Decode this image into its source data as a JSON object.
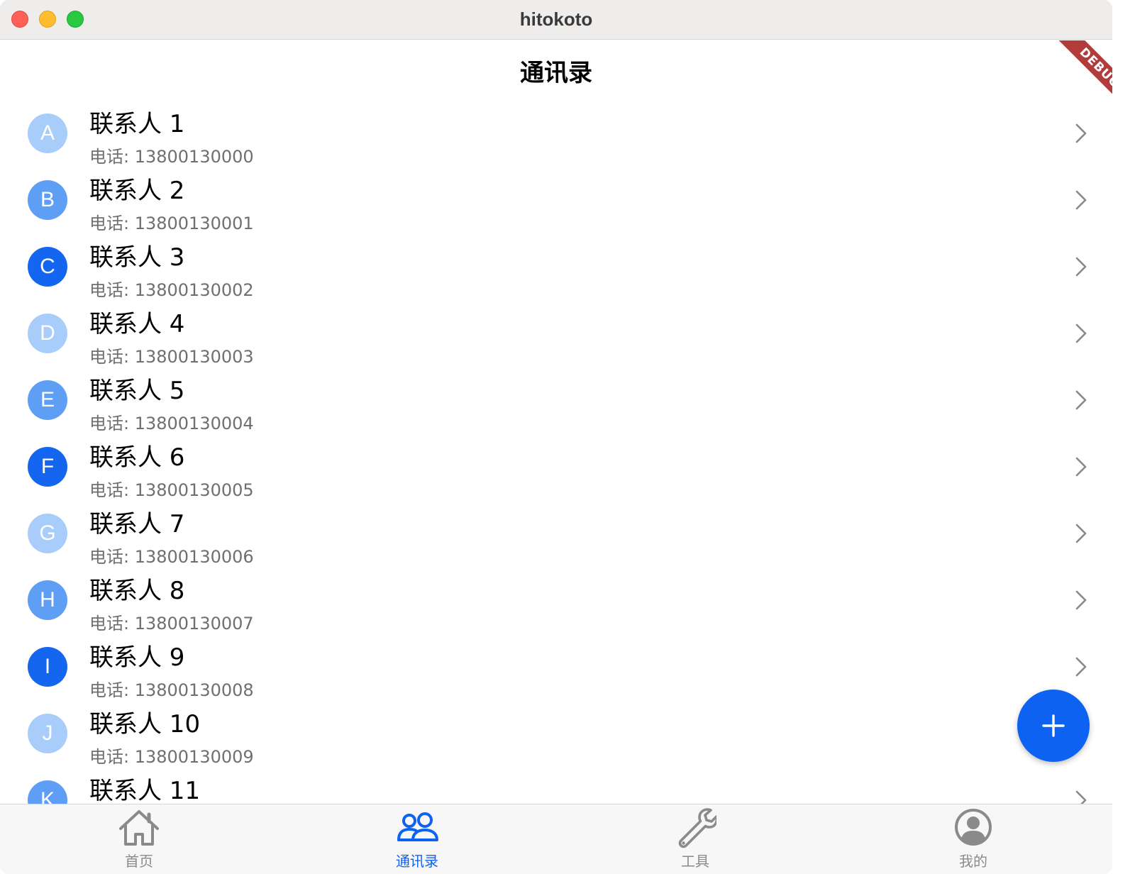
{
  "window": {
    "title": "hitokoto"
  },
  "appbar": {
    "title": "通讯录"
  },
  "debug_banner": "DEBUG",
  "contacts": [
    {
      "initial": "A",
      "name": "联系人 1",
      "phone": "电话: 13800130000",
      "color": "#a8cdfa"
    },
    {
      "initial": "B",
      "name": "联系人 2",
      "phone": "电话: 13800130001",
      "color": "#5f9ef5"
    },
    {
      "initial": "C",
      "name": "联系人 3",
      "phone": "电话: 13800130002",
      "color": "#1466f0"
    },
    {
      "initial": "D",
      "name": "联系人 4",
      "phone": "电话: 13800130003",
      "color": "#a8cdfa"
    },
    {
      "initial": "E",
      "name": "联系人 5",
      "phone": "电话: 13800130004",
      "color": "#5f9ef5"
    },
    {
      "initial": "F",
      "name": "联系人 6",
      "phone": "电话: 13800130005",
      "color": "#1466f0"
    },
    {
      "initial": "G",
      "name": "联系人 7",
      "phone": "电话: 13800130006",
      "color": "#a8cdfa"
    },
    {
      "initial": "H",
      "name": "联系人 8",
      "phone": "电话: 13800130007",
      "color": "#5f9ef5"
    },
    {
      "initial": "I",
      "name": "联系人 9",
      "phone": "电话: 13800130008",
      "color": "#1466f0"
    },
    {
      "initial": "J",
      "name": "联系人 10",
      "phone": "电话: 13800130009",
      "color": "#a8cdfa"
    },
    {
      "initial": "K",
      "name": "联系人 11",
      "phone": "",
      "color": "#5f9ef5"
    }
  ],
  "fab": {
    "icon": "plus-icon"
  },
  "tabs": [
    {
      "label": "首页",
      "icon": "home-icon",
      "active": false
    },
    {
      "label": "通讯录",
      "icon": "contacts-icon",
      "active": true
    },
    {
      "label": "工具",
      "icon": "wrench-icon",
      "active": false
    },
    {
      "label": "我的",
      "icon": "profile-icon",
      "active": false
    }
  ],
  "colors": {
    "accent": "#0e62f2",
    "inactive_tab": "#8a8a8a"
  }
}
